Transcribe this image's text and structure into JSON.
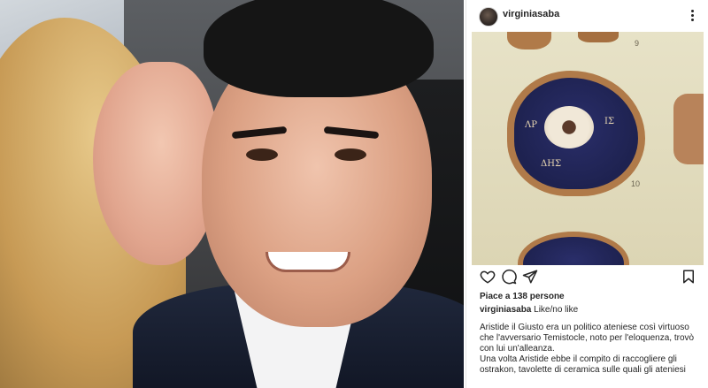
{
  "post": {
    "username": "virginiasaba",
    "image_labels": {
      "n9": "9",
      "n10": "10"
    },
    "likes_text": "Piace a 138 persone",
    "caption_user": "virginiasaba",
    "caption_inline": "Like/no like",
    "caption_paragraphs": [
      "Aristide il Giusto era un politico ateniese così virtuoso che l'avversario Temistocle, noto per l'eloquenza, trovò con lui un'alleanza.",
      "Una volta Aristide ebbe il compito di raccogliere gli ostrakon, tavolette di ceramica sulle quali gli ateniesi"
    ],
    "icons": [
      "heart-icon",
      "comment-icon",
      "share-icon",
      "bookmark-icon",
      "more-icon"
    ]
  },
  "colors": {
    "text": "#262626",
    "border": "#e5e5e5",
    "card_bg": "#ffffff",
    "ceramic_blue": "#1e2250",
    "ceramic_orange": "#b07a49"
  }
}
